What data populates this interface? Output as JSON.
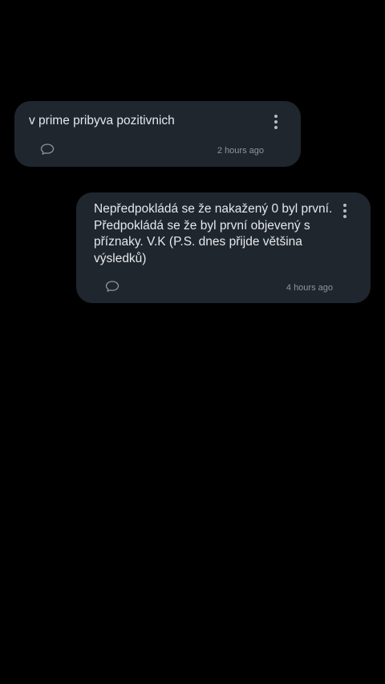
{
  "comments": [
    {
      "text": "v prime pribyva pozitivnich",
      "timestamp": "2 hours ago",
      "icons": {
        "reply": "speech-bubble-icon",
        "menu": "more-vertical-icon"
      }
    },
    {
      "text": "Nepředpokládá se že nakažený 0 byl první. Předpokládá se že byl první objevený s příznaky. V.K (P.S. dnes přijde většina výsledků)",
      "timestamp": "4 hours ago",
      "icons": {
        "reply": "speech-bubble-icon",
        "menu": "more-vertical-icon"
      }
    }
  ],
  "colors": {
    "background": "#000000",
    "card": "#1f262e",
    "text": "#e6e8ea",
    "muted": "#8e959c"
  }
}
